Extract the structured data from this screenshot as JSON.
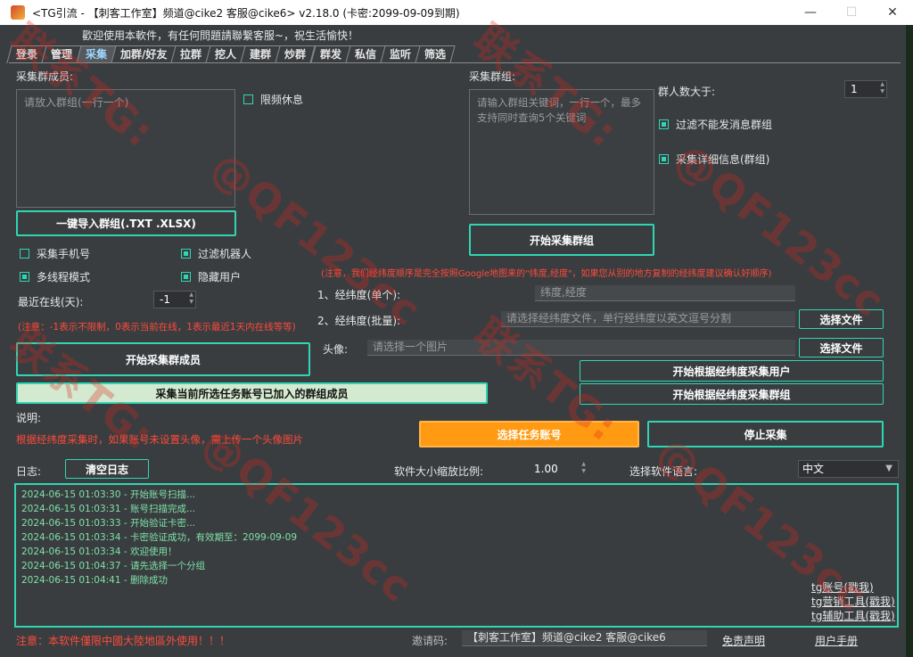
{
  "window": {
    "title": "<TG引流 - 【刺客工作室】频道@cike2 客服@cike6> v2.18.0 (卡密:2099-09-09到期)",
    "minimize": "—",
    "maximize": "☐",
    "close": "✕"
  },
  "welcome": "歡迎使用本軟件，有任何問題請聯繫客服~，祝生活愉快！",
  "tabs": [
    "登录",
    "管理",
    "采集",
    "加群/好友",
    "拉群",
    "挖人",
    "建群",
    "炒群",
    "群发",
    "私信",
    "监听",
    "筛选"
  ],
  "active_tab": "采集",
  "left": {
    "members_label": "采集群成员:",
    "group_input_placeholder": "请放入群组(一行一个)",
    "rate_limit_rest": "限频休息",
    "import_button": "一键导入群组(.TXT .XLSX)",
    "collect_phone": "采集手机号",
    "filter_bots": "过滤机器人",
    "multithread": "多线程模式",
    "hide_users": "隐藏用户",
    "recent_online_label": "最近在线(天):",
    "recent_online_value": "-1",
    "online_note": "(注意：-1表示不限制，0表示当前在线，1表示最近1天内在线等等)",
    "start_collect_members": "开始采集群成员",
    "collect_joined_groups": "采集当前所选任务账号已加入的群组成员",
    "explain_label": "说明:",
    "explain_note": "根据经纬度采集时，如果账号未设置头像，需上传一个头像图片"
  },
  "middle": {
    "groups_label": "采集群组:",
    "keyword_placeholder": "请输入群组关键词，一行一个，最多支持同时查询5个关键词",
    "start_collect_groups": "开始采集群组",
    "coord_note": "(注意，我们经纬度顺序是完全按照Google地图来的\"纬度,经度\"，如果您从别的地方复制的经纬度建议确认好顺序)",
    "coord_single_label": "1、经纬度(单个):",
    "coord_single_placeholder": "纬度,经度",
    "coord_batch_label": "2、经纬度(批量):",
    "coord_batch_placeholder": "请选择经纬度文件，单行经纬度以英文逗号分割",
    "select_file": "选择文件",
    "avatar_label": "头像:",
    "avatar_placeholder": "请选择一个图片",
    "select_file_2": "选择文件",
    "start_by_coord_users": "开始根据经纬度采集用户",
    "start_by_coord_groups": "开始根据经纬度采集群组",
    "select_task_account": "选择任务账号",
    "stop_collect": "停止采集"
  },
  "right": {
    "members_gt_label": "群人数大于:",
    "members_gt_value": "1",
    "filter_no_msg_groups": "过滤不能发消息群组",
    "collect_group_details": "采集详细信息(群组)"
  },
  "log_bar": {
    "log_label": "日志:",
    "clear_log": "清空日志",
    "scale_label": "软件大小缩放比例:",
    "scale_value": "1.00",
    "language_label": "选择软件语言:",
    "language_value": "中文"
  },
  "log_lines": [
    "2024-06-15 01:03:30 - 开始账号扫描...",
    "2024-06-15 01:03:31 - 账号扫描完成...",
    "2024-06-15 01:03:33 - 开始验证卡密...",
    "2024-06-15 01:03:34 - 卡密验证成功，有效期至：2099-09-09",
    "2024-06-15 01:03:34 - 欢迎使用！",
    "2024-06-15 01:04:37 - 请先选择一个分组",
    "2024-06-15 01:04:41 - 删除成功"
  ],
  "links": [
    "tg账号(戳我)",
    "tg营销工具(戳我)",
    "tg辅助工具(戳我)"
  ],
  "footer": {
    "notice": "注意：本软件僅限中國大陸地區外使用！！！",
    "invite_label": "邀请码:",
    "invite_value": "【刺客工作室】频道@cike2 客服@cike6",
    "disclaimer": "免责声明",
    "manual": "用户手册"
  },
  "watermark": [
    "联系TG:",
    "@QF123cc"
  ],
  "colors": {
    "accent": "#2fd6b4",
    "warning": "#ff4a3a",
    "orange": "#ff9a12",
    "log_text": "#7ee2a8"
  }
}
